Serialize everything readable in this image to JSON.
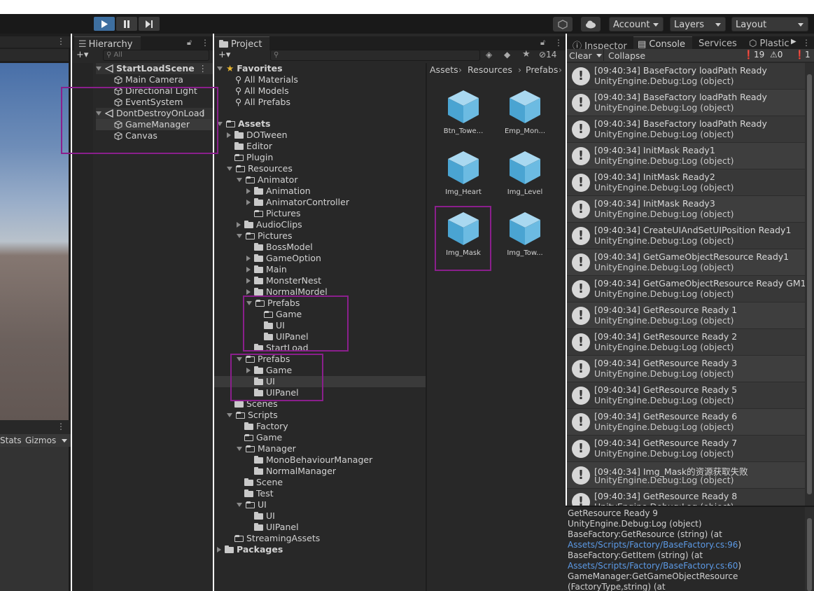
{
  "toolbar": {
    "account": "Account",
    "layers": "Layers",
    "layout": "Layout"
  },
  "scene_panel": {
    "stats": "Stats",
    "gizmos": "Gizmos"
  },
  "hierarchy": {
    "tab": "Hierarchy",
    "search_placeholder": "All",
    "items": [
      {
        "label": "StartLoadScene"
      },
      {
        "label": "Main Camera"
      },
      {
        "label": "Directional Light"
      },
      {
        "label": "EventSystem"
      },
      {
        "label": "DontDestroyOnLoad"
      },
      {
        "label": "GameManager"
      },
      {
        "label": "Canvas"
      }
    ]
  },
  "project": {
    "tab": "Project",
    "hidden_count": "14",
    "favorites": {
      "label": "Favorites",
      "items": [
        "All Materials",
        "All Models",
        "All Prefabs"
      ]
    },
    "tree": [
      {
        "label": "Assets"
      },
      {
        "label": "DOTween"
      },
      {
        "label": "Editor"
      },
      {
        "label": "Plugin"
      },
      {
        "label": "Resources"
      },
      {
        "label": "Animator"
      },
      {
        "label": "Animation"
      },
      {
        "label": "AnimatorController"
      },
      {
        "label": "Pictures"
      },
      {
        "label": "AudioClips"
      },
      {
        "label": "Pictures"
      },
      {
        "label": "BossModel"
      },
      {
        "label": "GameOption"
      },
      {
        "label": "Main"
      },
      {
        "label": "MonsterNest"
      },
      {
        "label": "NormalMordel"
      },
      {
        "label": "Prefabs"
      },
      {
        "label": "Game"
      },
      {
        "label": "UI"
      },
      {
        "label": "UIPanel"
      },
      {
        "label": "StartLoad"
      },
      {
        "label": "Prefabs"
      },
      {
        "label": "Game"
      },
      {
        "label": "UI"
      },
      {
        "label": "UIPanel"
      },
      {
        "label": "Scenes"
      },
      {
        "label": "Scripts"
      },
      {
        "label": "Factory"
      },
      {
        "label": "Game"
      },
      {
        "label": "Manager"
      },
      {
        "label": "MonoBehaviourManager"
      },
      {
        "label": "NormalManager"
      },
      {
        "label": "Scene"
      },
      {
        "label": "Test"
      },
      {
        "label": "UI"
      },
      {
        "label": "UI"
      },
      {
        "label": "UIPanel"
      },
      {
        "label": "StreamingAssets"
      },
      {
        "label": "Packages"
      }
    ],
    "breadcrumb": [
      "Assets",
      "Resources",
      "Prefabs"
    ],
    "assets": [
      "Btn_Towe...",
      "Emp_Mon...",
      "Img_Heart",
      "Img_Level",
      "Img_Mask",
      "Img_Tow..."
    ]
  },
  "right_tabs": {
    "inspector": "Inspector",
    "console": "Console",
    "services": "Services",
    "plastic": "Plastic"
  },
  "console": {
    "clear": "Clear",
    "collapse": "Collapse",
    "info_count": "19",
    "warn_count": "0",
    "error_count": "1",
    "entries": [
      {
        "msg": "[09:40:34] BaseFactory loadPath Ready",
        "src": "UnityEngine.Debug:Log (object)"
      },
      {
        "msg": "[09:40:34] BaseFactory loadPath Ready",
        "src": "UnityEngine.Debug:Log (object)"
      },
      {
        "msg": "[09:40:34] BaseFactory loadPath Ready",
        "src": "UnityEngine.Debug:Log (object)"
      },
      {
        "msg": "[09:40:34] InitMask Ready1",
        "src": "UnityEngine.Debug:Log (object)"
      },
      {
        "msg": "[09:40:34] InitMask Ready2",
        "src": "UnityEngine.Debug:Log (object)"
      },
      {
        "msg": "[09:40:34] InitMask Ready3",
        "src": "UnityEngine.Debug:Log (object)"
      },
      {
        "msg": "[09:40:34] CreateUIAndSetUIPosition Ready1",
        "src": "UnityEngine.Debug:Log (object)"
      },
      {
        "msg": "[09:40:34] GetGameObjectResource Ready1",
        "src": "UnityEngine.Debug:Log (object)"
      },
      {
        "msg": "[09:40:34] GetGameObjectResource Ready GM1",
        "src": "UnityEngine.Debug:Log (object)"
      },
      {
        "msg": "[09:40:34] GetResource Ready 1",
        "src": "UnityEngine.Debug:Log (object)"
      },
      {
        "msg": "[09:40:34] GetResource Ready 2",
        "src": "UnityEngine.Debug:Log (object)"
      },
      {
        "msg": "[09:40:34] GetResource Ready 3",
        "src": "UnityEngine.Debug:Log (object)"
      },
      {
        "msg": "[09:40:34] GetResource Ready 5",
        "src": "UnityEngine.Debug:Log (object)"
      },
      {
        "msg": "[09:40:34] GetResource Ready 6",
        "src": "UnityEngine.Debug:Log (object)"
      },
      {
        "msg": "[09:40:34] GetResource Ready 7",
        "src": "UnityEngine.Debug:Log (object)"
      },
      {
        "msg": "[09:40:34] Img_Mask的资源获取失败",
        "src": "UnityEngine.Debug:Log (object)"
      },
      {
        "msg": "[09:40:34] GetResource Ready 8",
        "src": "UnityEngine.Debug:Log (object)"
      }
    ],
    "details": [
      "GetResource Ready 9",
      "UnityEngine.Debug:Log (object)",
      "BaseFactory:GetResource (string) (at",
      "Assets/Scripts/Factory/BaseFactory.cs:96",
      ")",
      "BaseFactory:GetItem (string) (at",
      "Assets/Scripts/Factory/BaseFactory.cs:60",
      ")",
      "GameManager:GetGameObjectResource",
      "(FactoryType,string) (at"
    ]
  }
}
